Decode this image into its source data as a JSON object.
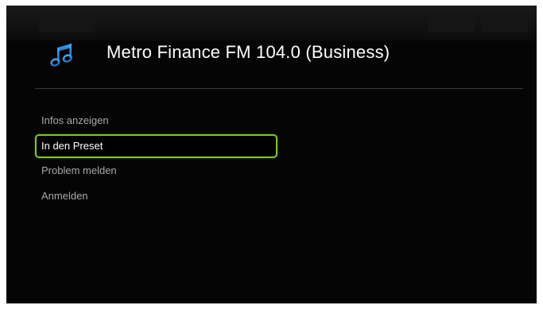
{
  "header": {
    "icon": "music-note-icon",
    "station_name": "Metro Finance FM 104.0 (Business)"
  },
  "menu": {
    "items": [
      {
        "label": "Infos anzeigen",
        "selected": false
      },
      {
        "label": "In den Preset",
        "selected": true
      },
      {
        "label": "Problem melden",
        "selected": false
      },
      {
        "label": "Anmelden",
        "selected": false
      }
    ]
  },
  "colors": {
    "background": "#050505",
    "selection_border": "#7ec23e",
    "icon": "#2f8ad8",
    "text_selected": "#ffffff",
    "text_normal": "#a9a9a9"
  }
}
